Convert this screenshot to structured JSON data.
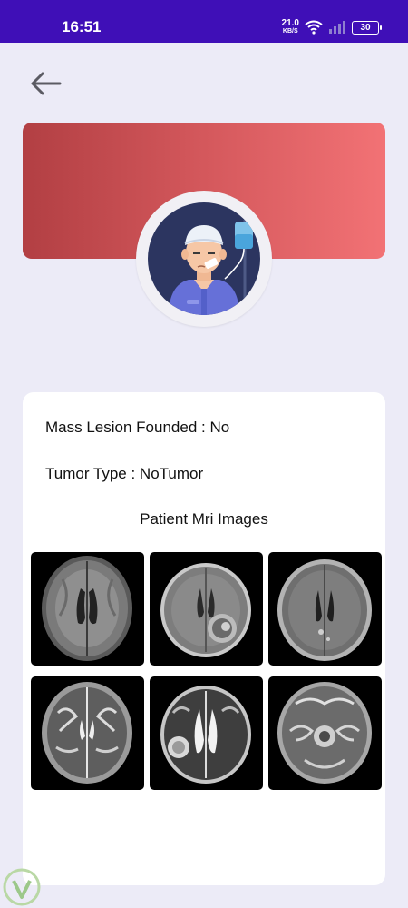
{
  "status_bar": {
    "time": "16:51",
    "net_speed_value": "21.0",
    "net_speed_unit": "KB/S",
    "battery": "30",
    "bg_color": "#3f0fb7"
  },
  "nav": {
    "back_icon": "arrow-left-icon"
  },
  "header": {
    "gradient_start": "#b23f43",
    "gradient_end": "#f27275",
    "avatar_icon": "patient-avatar-icon"
  },
  "patient": {
    "mass_lesion": "Mass Lesion Founded : No",
    "tumor_type": "Tumor Type : NoTumor"
  },
  "mri": {
    "title": "Patient Mri Images",
    "images": [
      {
        "kind": "t1-axial"
      },
      {
        "kind": "t1-contrast-lesion"
      },
      {
        "kind": "t1-contrast"
      },
      {
        "kind": "t2-axial"
      },
      {
        "kind": "t2-lesion"
      },
      {
        "kind": "t2-posterior-fossa"
      }
    ]
  }
}
